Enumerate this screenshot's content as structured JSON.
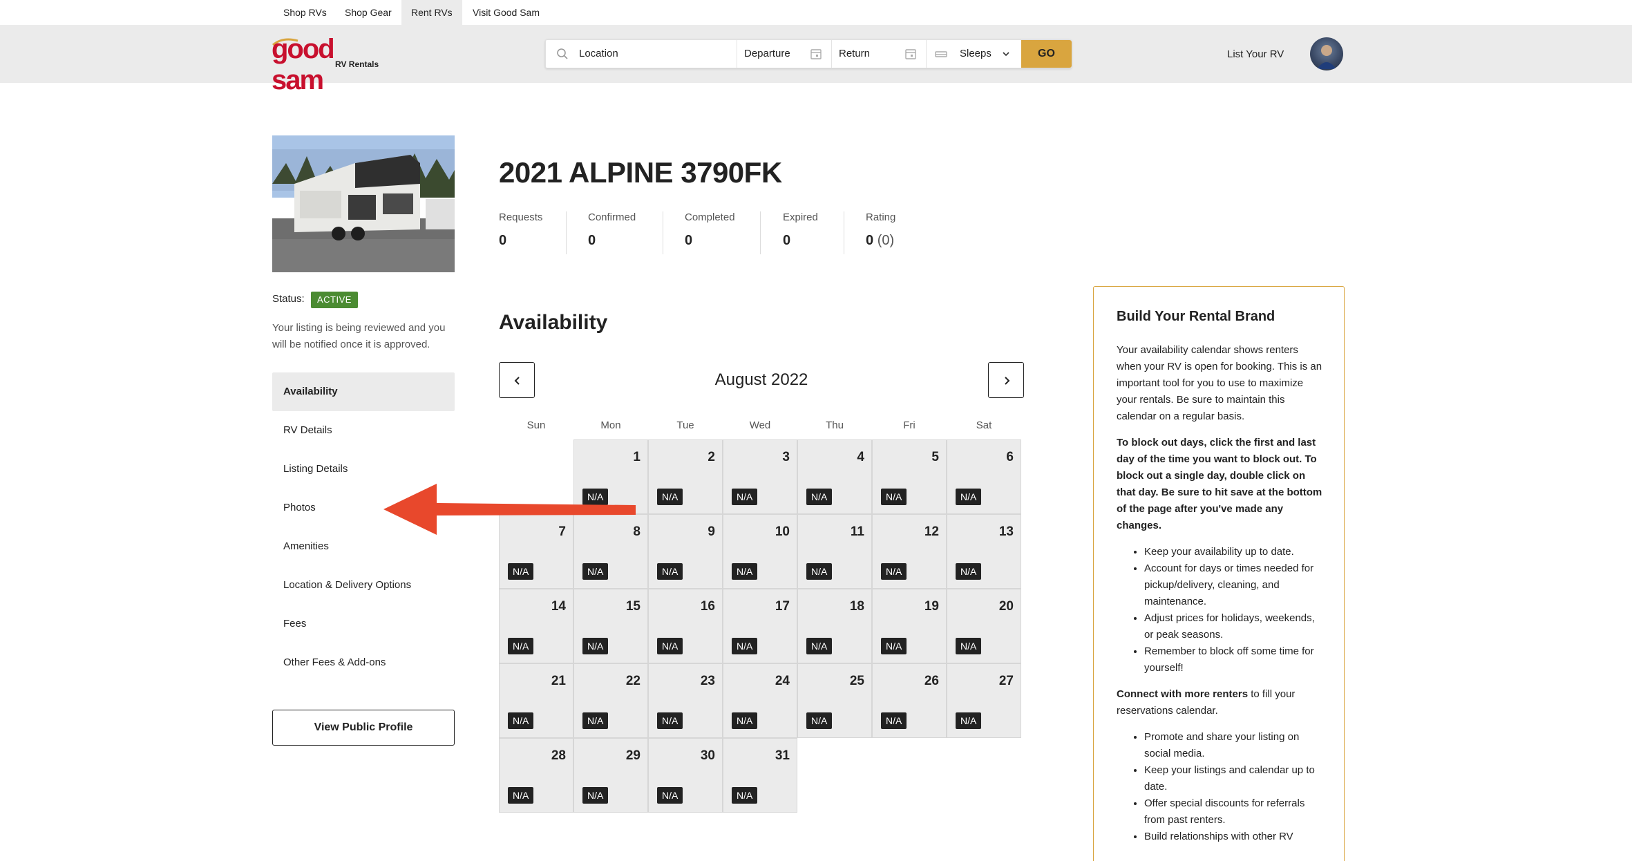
{
  "top_tabs": [
    {
      "label": "Shop RVs"
    },
    {
      "label": "Shop Gear"
    },
    {
      "label": "Rent RVs"
    },
    {
      "label": "Visit Good Sam"
    }
  ],
  "logo": {
    "word": "good sam",
    "sub": "RV Rentals"
  },
  "search": {
    "location_placeholder": "Location",
    "departure": "Departure",
    "return": "Return",
    "sleeps": "Sleeps",
    "go": "GO"
  },
  "header": {
    "list_rv": "List Your RV"
  },
  "listing": {
    "title": "2021 ALPINE 3790FK",
    "status_label": "Status:",
    "status_value": "ACTIVE",
    "review_note": "Your listing is being reviewed and you will be notified once it is approved."
  },
  "stats": [
    {
      "label": "Requests",
      "value": "0"
    },
    {
      "label": "Confirmed",
      "value": "0"
    },
    {
      "label": "Completed",
      "value": "0"
    },
    {
      "label": "Expired",
      "value": "0"
    },
    {
      "label": "Rating",
      "value": "0",
      "sub": "(0)"
    }
  ],
  "nav": [
    {
      "label": "Availability"
    },
    {
      "label": "RV Details"
    },
    {
      "label": "Listing Details"
    },
    {
      "label": "Photos"
    },
    {
      "label": "Amenities"
    },
    {
      "label": "Location & Delivery Options"
    },
    {
      "label": "Fees"
    },
    {
      "label": "Other Fees & Add-ons"
    }
  ],
  "view_profile": "View Public Profile",
  "availability": {
    "heading": "Availability",
    "month": "August 2022",
    "weekdays": [
      "Sun",
      "Mon",
      "Tue",
      "Wed",
      "Thu",
      "Fri",
      "Sat"
    ],
    "first_weekday_index": 1,
    "days": [
      "1",
      "2",
      "3",
      "4",
      "5",
      "6",
      "7",
      "8",
      "9",
      "10",
      "11",
      "12",
      "13",
      "14",
      "15",
      "16",
      "17",
      "18",
      "19",
      "20",
      "21",
      "22",
      "23",
      "24",
      "25",
      "26",
      "27",
      "28",
      "29",
      "30",
      "31"
    ],
    "day_label": "N/A"
  },
  "brand_card": {
    "title": "Build Your Rental Brand",
    "intro": "Your availability calendar shows renters when your RV is open for booking.  This is an important tool for you to use to maximize your rentals.  Be sure to maintain this calendar on a regular basis.",
    "instructions": "To block out days, click the first and last day of the time you want to block out.  To block out a single day, double click on that day.  Be sure to hit save at the bottom of the page after you've made any changes.",
    "tips": [
      "Keep your availability up to date.",
      "Account for days or times needed for pickup/delivery, cleaning, and maintenance.",
      "Adjust prices for holidays, weekends, or peak seasons.",
      "Remember to block off some time for yourself!"
    ],
    "connect_bold": "Connect with more renters",
    "connect_rest": " to fill your reservations calendar.",
    "connect_tips": [
      "Promote and share your listing on social media.",
      "Keep your listings and calendar up to date.",
      "Offer special discounts for referrals from past renters.",
      "Build relationships with other RV"
    ]
  },
  "colors": {
    "accent_gold": "#d9a53f",
    "active_green": "#4b8b32",
    "logo_red": "#c8102e",
    "arrow_red": "#e8482c"
  }
}
